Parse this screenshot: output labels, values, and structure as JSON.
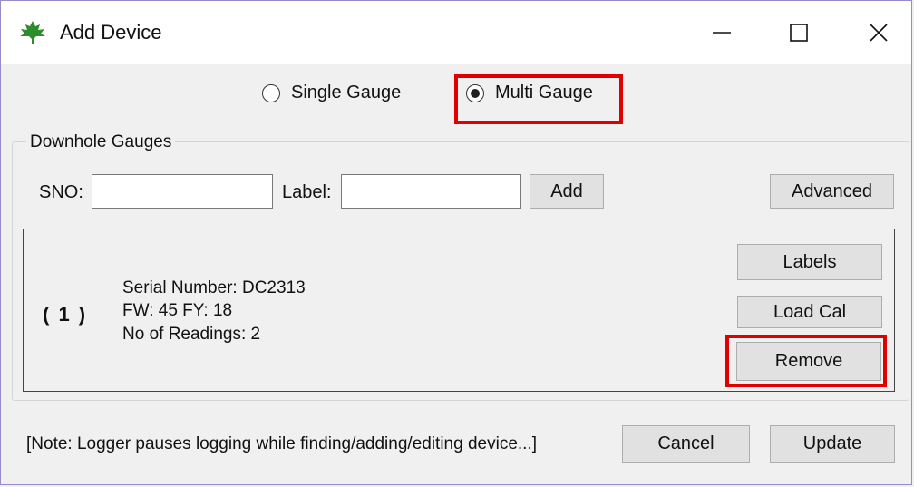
{
  "window": {
    "title": "Add Device",
    "icon": "maple-leaf-icon",
    "controls": [
      "minimize-icon",
      "maximize-icon",
      "close-icon"
    ]
  },
  "mode": {
    "options": [
      {
        "label": "Single Gauge",
        "selected": false
      },
      {
        "label": "Multi Gauge",
        "selected": true
      }
    ]
  },
  "group": {
    "title": "Downhole Gauges",
    "sno_label": "SNO:",
    "sno_value": "",
    "label_label": "Label:",
    "label_value": "",
    "add_label": "Add",
    "advanced_label": "Advanced"
  },
  "device": {
    "index": "( 1 )",
    "serial": "Serial Number: DC2313",
    "fw": "FW: 45 FY: 18",
    "readings": "No of Readings: 2",
    "buttons": {
      "labels": "Labels",
      "load_cal": "Load Cal",
      "remove": "Remove"
    }
  },
  "footer": {
    "note": "[Note: Logger pauses logging while finding/adding/editing device...]",
    "cancel_label": "Cancel",
    "update_label": "Update"
  },
  "colors": {
    "highlight": "#e00000",
    "icon_green": "#2e8b2e",
    "background": "#f0f0f0"
  }
}
